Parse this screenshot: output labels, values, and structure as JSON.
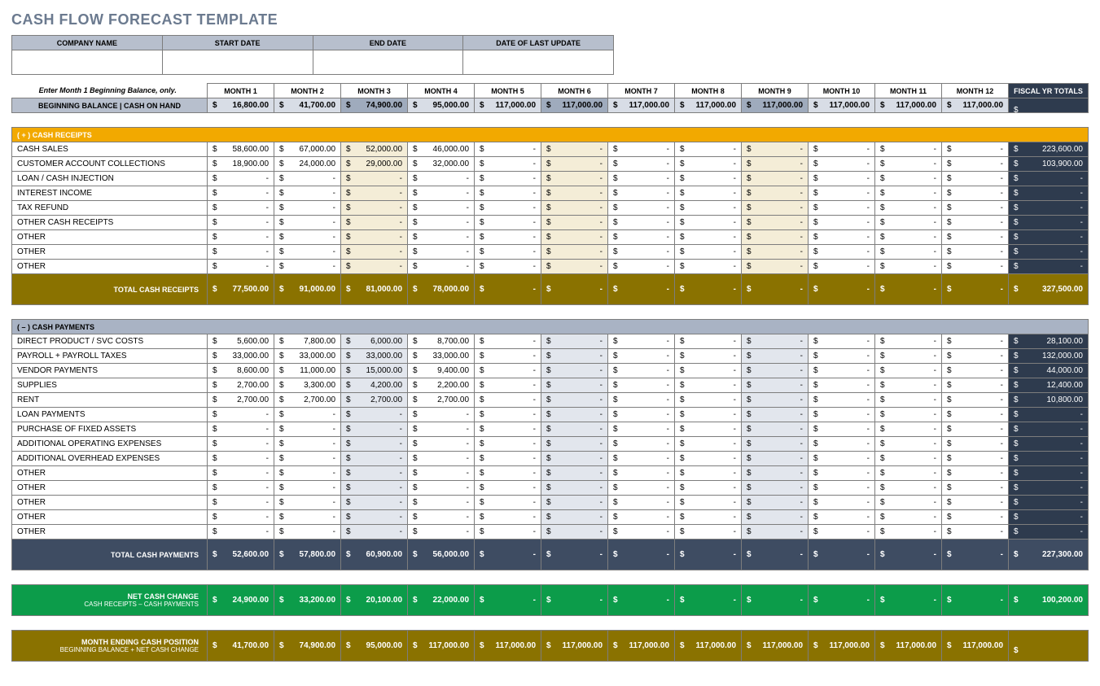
{
  "title": "CASH FLOW FORECAST TEMPLATE",
  "meta": {
    "h": [
      "COMPANY NAME",
      "START DATE",
      "END DATE",
      "DATE OF LAST UPDATE"
    ]
  },
  "instr": "Enter Month 1 Beginning Balance, only.",
  "months": [
    "MONTH 1",
    "MONTH 2",
    "MONTH 3",
    "MONTH 4",
    "MONTH 5",
    "MONTH 6",
    "MONTH 7",
    "MONTH 8",
    "MONTH 9",
    "MONTH 10",
    "MONTH 11",
    "MONTH 12"
  ],
  "fy": "FISCAL YR TOTALS",
  "beg": {
    "lbl": "BEGINNING BALANCE | CASH ON HAND",
    "v": [
      "16,800.00",
      "41,700.00",
      "74,900.00",
      "95,000.00",
      "117,000.00",
      "117,000.00",
      "117,000.00",
      "117,000.00",
      "117,000.00",
      "117,000.00",
      "117,000.00",
      "117,000.00"
    ]
  },
  "rec": {
    "hdr": "( + )  CASH RECEIPTS",
    "rows": [
      {
        "l": "CASH SALES",
        "v": [
          "58,600.00",
          "67,000.00",
          "52,000.00",
          "46,000.00",
          "-",
          "-",
          "-",
          "-",
          "-",
          "-",
          "-",
          "-"
        ],
        "t": "223,600.00"
      },
      {
        "l": "CUSTOMER ACCOUNT COLLECTIONS",
        "v": [
          "18,900.00",
          "24,000.00",
          "29,000.00",
          "32,000.00",
          "-",
          "-",
          "-",
          "-",
          "-",
          "-",
          "-",
          "-"
        ],
        "t": "103,900.00"
      },
      {
        "l": "LOAN / CASH INJECTION",
        "v": [
          "-",
          "-",
          "-",
          "-",
          "-",
          "-",
          "-",
          "-",
          "-",
          "-",
          "-",
          "-"
        ],
        "t": "-"
      },
      {
        "l": "INTEREST INCOME",
        "v": [
          "-",
          "-",
          "-",
          "-",
          "-",
          "-",
          "-",
          "-",
          "-",
          "-",
          "-",
          "-"
        ],
        "t": "-"
      },
      {
        "l": "TAX REFUND",
        "v": [
          "-",
          "-",
          "-",
          "-",
          "-",
          "-",
          "-",
          "-",
          "-",
          "-",
          "-",
          "-"
        ],
        "t": "-"
      },
      {
        "l": "OTHER CASH RECEIPTS",
        "v": [
          "-",
          "-",
          "-",
          "-",
          "-",
          "-",
          "-",
          "-",
          "-",
          "-",
          "-",
          "-"
        ],
        "t": "-"
      },
      {
        "l": "OTHER",
        "v": [
          "-",
          "-",
          "-",
          "-",
          "-",
          "-",
          "-",
          "-",
          "-",
          "-",
          "-",
          "-"
        ],
        "t": "-"
      },
      {
        "l": "OTHER",
        "v": [
          "-",
          "-",
          "-",
          "-",
          "-",
          "-",
          "-",
          "-",
          "-",
          "-",
          "-",
          "-"
        ],
        "t": "-"
      },
      {
        "l": "OTHER",
        "v": [
          "-",
          "-",
          "-",
          "-",
          "-",
          "-",
          "-",
          "-",
          "-",
          "-",
          "-",
          "-"
        ],
        "t": "-"
      }
    ],
    "tot": {
      "l": "TOTAL CASH RECEIPTS",
      "v": [
        "77,500.00",
        "91,000.00",
        "81,000.00",
        "78,000.00",
        "-",
        "-",
        "-",
        "-",
        "-",
        "-",
        "-",
        "-"
      ],
      "t": "327,500.00"
    }
  },
  "pay": {
    "hdr": "( – )  CASH PAYMENTS",
    "rows": [
      {
        "l": "DIRECT PRODUCT / SVC COSTS",
        "v": [
          "5,600.00",
          "7,800.00",
          "6,000.00",
          "8,700.00",
          "-",
          "-",
          "-",
          "-",
          "-",
          "-",
          "-",
          "-"
        ],
        "t": "28,100.00"
      },
      {
        "l": "PAYROLL + PAYROLL TAXES",
        "v": [
          "33,000.00",
          "33,000.00",
          "33,000.00",
          "33,000.00",
          "-",
          "-",
          "-",
          "-",
          "-",
          "-",
          "-",
          "-"
        ],
        "t": "132,000.00"
      },
      {
        "l": "VENDOR PAYMENTS",
        "v": [
          "8,600.00",
          "11,000.00",
          "15,000.00",
          "9,400.00",
          "-",
          "-",
          "-",
          "-",
          "-",
          "-",
          "-",
          "-"
        ],
        "t": "44,000.00"
      },
      {
        "l": "SUPPLIES",
        "v": [
          "2,700.00",
          "3,300.00",
          "4,200.00",
          "2,200.00",
          "-",
          "-",
          "-",
          "-",
          "-",
          "-",
          "-",
          "-"
        ],
        "t": "12,400.00"
      },
      {
        "l": "RENT",
        "v": [
          "2,700.00",
          "2,700.00",
          "2,700.00",
          "2,700.00",
          "-",
          "-",
          "-",
          "-",
          "-",
          "-",
          "-",
          "-"
        ],
        "t": "10,800.00"
      },
      {
        "l": "LOAN PAYMENTS",
        "v": [
          "-",
          "-",
          "-",
          "-",
          "-",
          "-",
          "-",
          "-",
          "-",
          "-",
          "-",
          "-"
        ],
        "t": "-"
      },
      {
        "l": "PURCHASE OF FIXED ASSETS",
        "v": [
          "-",
          "-",
          "-",
          "-",
          "-",
          "-",
          "-",
          "-",
          "-",
          "-",
          "-",
          "-"
        ],
        "t": "-"
      },
      {
        "l": "ADDITIONAL OPERATING EXPENSES",
        "v": [
          "-",
          "-",
          "-",
          "-",
          "-",
          "-",
          "-",
          "-",
          "-",
          "-",
          "-",
          "-"
        ],
        "t": "-"
      },
      {
        "l": "ADDITIONAL OVERHEAD EXPENSES",
        "v": [
          "-",
          "-",
          "-",
          "-",
          "-",
          "-",
          "-",
          "-",
          "-",
          "-",
          "-",
          "-"
        ],
        "t": "-"
      },
      {
        "l": "OTHER",
        "v": [
          "-",
          "-",
          "-",
          "-",
          "-",
          "-",
          "-",
          "-",
          "-",
          "-",
          "-",
          "-"
        ],
        "t": "-"
      },
      {
        "l": "OTHER",
        "v": [
          "-",
          "-",
          "-",
          "-",
          "-",
          "-",
          "-",
          "-",
          "-",
          "-",
          "-",
          "-"
        ],
        "t": "-"
      },
      {
        "l": "OTHER",
        "v": [
          "-",
          "-",
          "-",
          "-",
          "-",
          "-",
          "-",
          "-",
          "-",
          "-",
          "-",
          "-"
        ],
        "t": "-"
      },
      {
        "l": "OTHER",
        "v": [
          "-",
          "-",
          "-",
          "-",
          "-",
          "-",
          "-",
          "-",
          "-",
          "-",
          "-",
          "-"
        ],
        "t": "-"
      },
      {
        "l": "OTHER",
        "v": [
          "-",
          "-",
          "-",
          "-",
          "-",
          "-",
          "-",
          "-",
          "-",
          "-",
          "-",
          "-"
        ],
        "t": "-"
      }
    ],
    "tot": {
      "l": "TOTAL CASH PAYMENTS",
      "v": [
        "52,600.00",
        "57,800.00",
        "60,900.00",
        "56,000.00",
        "-",
        "-",
        "-",
        "-",
        "-",
        "-",
        "-",
        "-"
      ],
      "t": "227,300.00"
    }
  },
  "net": {
    "l": "NET CASH CHANGE",
    "s": "CASH RECEIPTS – CASH PAYMENTS",
    "v": [
      "24,900.00",
      "33,200.00",
      "20,100.00",
      "22,000.00",
      "-",
      "-",
      "-",
      "-",
      "-",
      "-",
      "-",
      "-"
    ],
    "t": "100,200.00"
  },
  "end": {
    "l": "MONTH ENDING CASH POSITION",
    "s": "BEGINNING BALANCE + NET CASH CHANGE",
    "v": [
      "41,700.00",
      "74,900.00",
      "95,000.00",
      "117,000.00",
      "117,000.00",
      "117,000.00",
      "117,000.00",
      "117,000.00",
      "117,000.00",
      "117,000.00",
      "117,000.00",
      "117,000.00"
    ],
    "t": ""
  },
  "hl": [
    2,
    5,
    8
  ]
}
